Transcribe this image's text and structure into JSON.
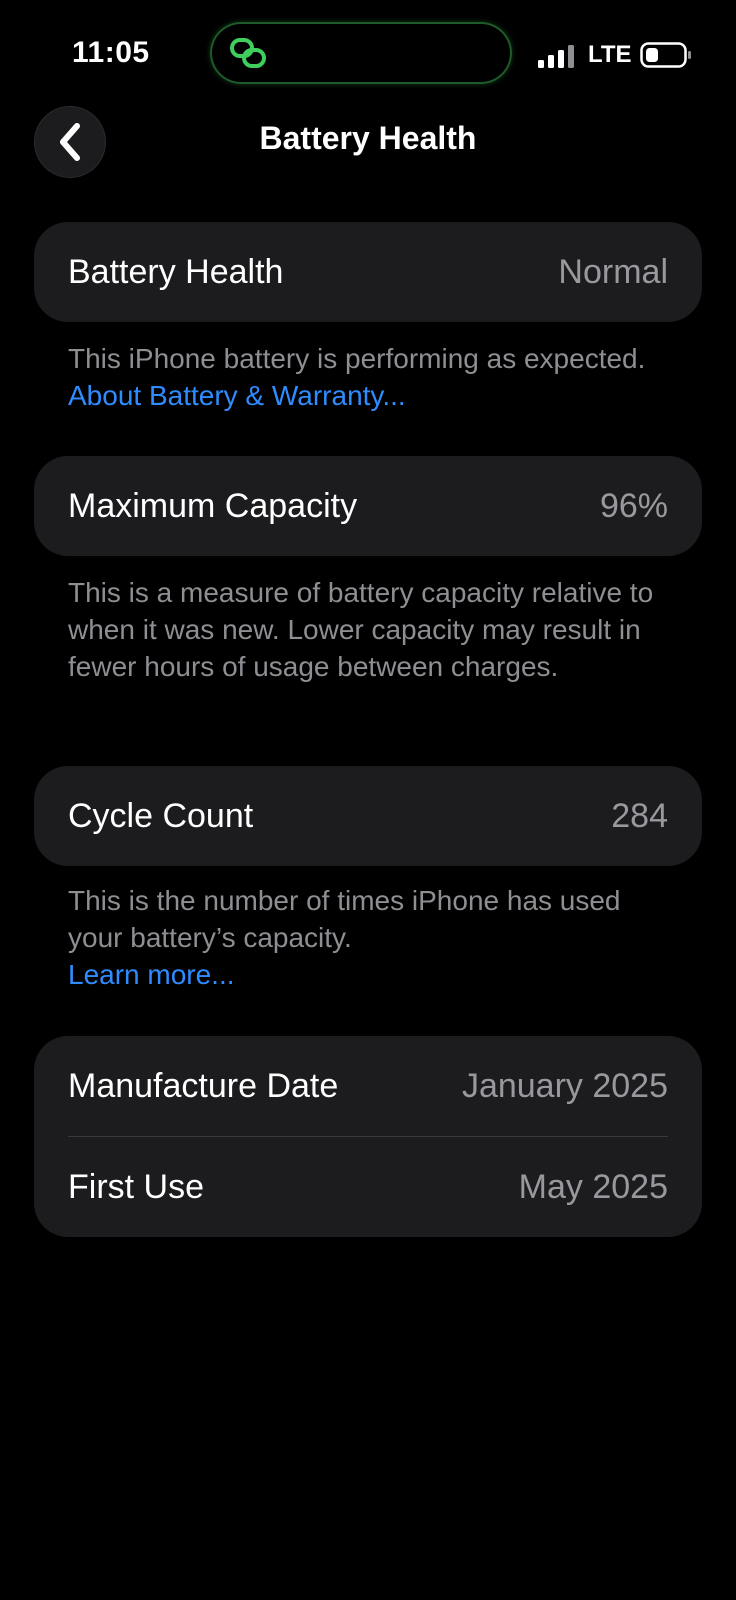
{
  "status_bar": {
    "time": "11:05",
    "network": "LTE",
    "island_icon": "link-rings-icon",
    "island_color": "#3ecf5c"
  },
  "nav": {
    "back_icon": "chevron-left-icon",
    "title": "Battery Health"
  },
  "health": {
    "label": "Battery Health",
    "value": "Normal",
    "description": "This iPhone battery is performing as expected.",
    "link": "About Battery & Warranty..."
  },
  "capacity": {
    "label": "Maximum Capacity",
    "value": "96%",
    "description": "This is a measure of battery capacity relative to when it was new. Lower capacity may result in fewer hours of usage between charges."
  },
  "cycles": {
    "label": "Cycle Count",
    "value": "284",
    "description": "This is the number of times iPhone has used your battery’s capacity.",
    "link": "Learn more..."
  },
  "dates": {
    "manufacture_label": "Manufacture Date",
    "manufacture_value": "January 2025",
    "first_use_label": "First Use",
    "first_use_value": "May 2025"
  },
  "colors": {
    "background": "#000000",
    "card": "#1c1c1e",
    "secondary_text": "#98989e",
    "link": "#2f8cff"
  }
}
